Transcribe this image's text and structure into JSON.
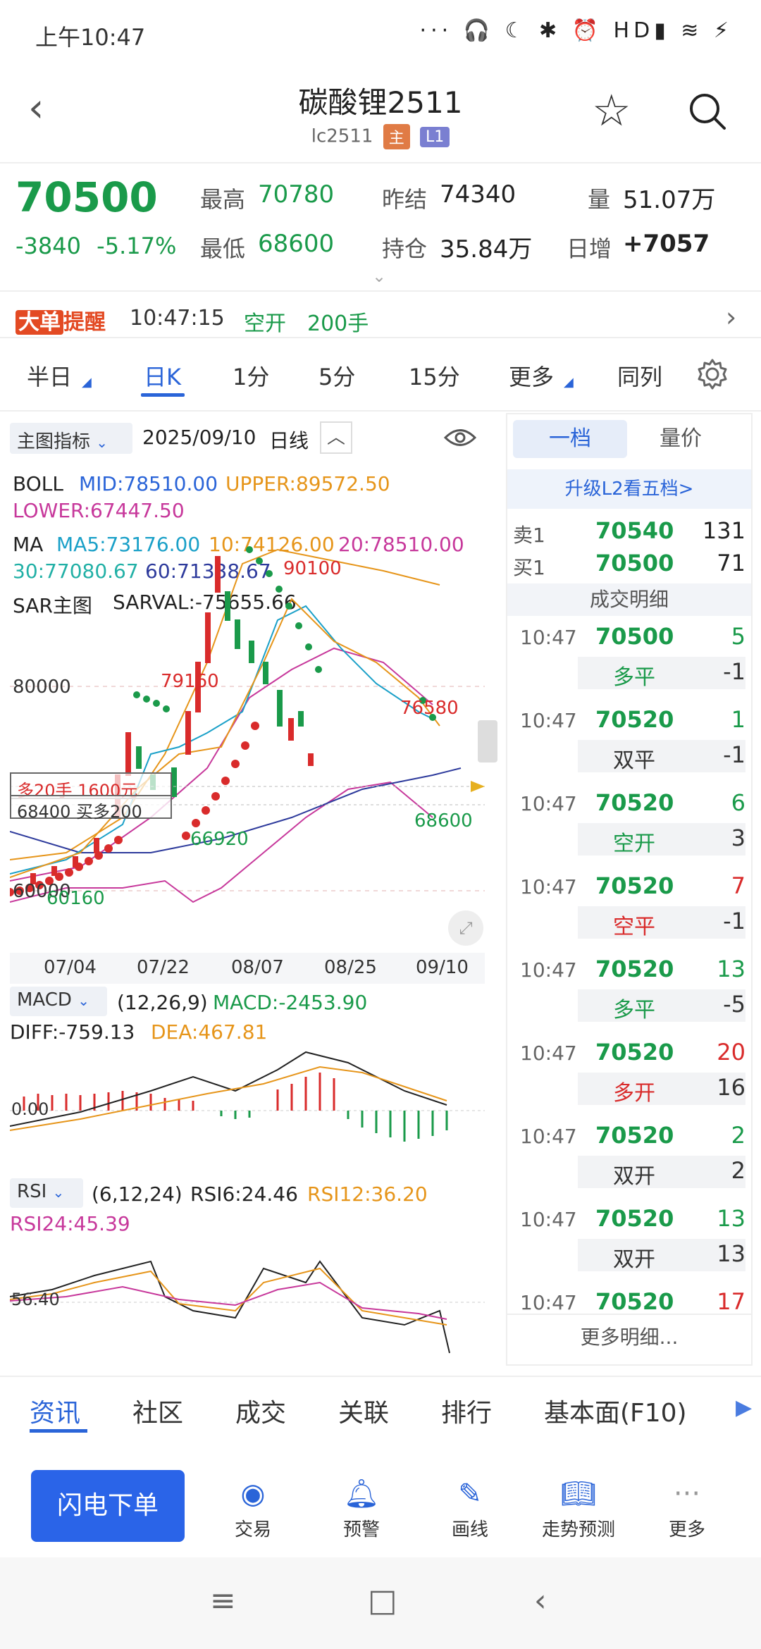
{
  "status_bar": {
    "time": "上午10:47",
    "icons": "··· 🎧 ☾ ✱ ⏰ HD▮ ≋ ⚡"
  },
  "header": {
    "title": "碳酸锂2511",
    "code": "lc2511",
    "tag_main": "主",
    "tag_level": "L1"
  },
  "quote": {
    "price": "70500",
    "change": "-3840",
    "change_pct": "-5.17%",
    "high_label": "最高",
    "high": "70780",
    "low_label": "最低",
    "low": "68600",
    "prev_label": "昨结",
    "prev": "74340",
    "oi_label": "持仓",
    "oi": "35.84万",
    "vol_label": "量",
    "vol": "51.07万",
    "daily_label": "日增",
    "daily": "+7057"
  },
  "alert": {
    "badge1": "大单",
    "badge2": "提醒",
    "time": "10:47:15",
    "action": "空开",
    "qty": "200手"
  },
  "period_tabs": [
    "半日",
    "日K",
    "1分",
    "5分",
    "15分",
    "更多",
    "同列"
  ],
  "chart_header": {
    "indicator_select": "主图指标",
    "date": "2025/09/10",
    "period": "日线"
  },
  "boll": {
    "label": "BOLL",
    "mid": "MID:78510.00",
    "upper": "UPPER:89572.50",
    "lower": "LOWER:67447.50"
  },
  "ma": {
    "label": "MA",
    "ma5": "MA5:73176.00",
    "ma10": "10:74126.00",
    "ma20": "20:78510.00",
    "ma30": "30:77080.67",
    "ma60": "60:71338.67"
  },
  "sar": {
    "label": "SAR主图",
    "value": "SARVAL:-75655.66"
  },
  "chart_annotations": {
    "level_80000": "80000",
    "level_60000": "60000",
    "peak": "90100",
    "p79160": "79160",
    "p76580": "76580",
    "p66920": "66920",
    "p68600": "68600",
    "p60160": "60160",
    "order1": "多20手 1600元",
    "order2": "68400 买多200"
  },
  "x_ticks": [
    "07/04",
    "07/22",
    "08/07",
    "08/25",
    "09/10"
  ],
  "macd": {
    "select": "MACD",
    "params": "(12,26,9)",
    "value": "MACD:-2453.90",
    "diff": "DIFF:-759.13",
    "dea": "DEA:467.81",
    "zero": "0.00"
  },
  "rsi": {
    "select": "RSI",
    "params": "(6,12,24)",
    "rsi6": "RSI6:24.46",
    "rsi12": "RSI12:36.20",
    "rsi24": "RSI24:45.39",
    "level": "56.40"
  },
  "right_panel": {
    "tab1": "一档",
    "tab2": "量价",
    "upgrade": "升级L2看五档>",
    "sell_label": "卖1",
    "sell_price": "70540",
    "sell_vol": "131",
    "buy_label": "买1",
    "buy_price": "70500",
    "buy_vol": "71",
    "detail_header": "成交明细",
    "trades": [
      {
        "time": "10:47",
        "price": "70500",
        "vol": "5",
        "vol_color": "#1a9a4a",
        "action": "多平",
        "act_color": "#1a9a4a",
        "act_vol": "-1"
      },
      {
        "time": "10:47",
        "price": "70520",
        "vol": "1",
        "vol_color": "#1a9a4a",
        "action": "双平",
        "act_color": "#333333",
        "act_vol": "-1"
      },
      {
        "time": "10:47",
        "price": "70520",
        "vol": "6",
        "vol_color": "#1a9a4a",
        "action": "空开",
        "act_color": "#1a9a4a",
        "act_vol": "3"
      },
      {
        "time": "10:47",
        "price": "70520",
        "vol": "7",
        "vol_color": "#d92b2b",
        "action": "空平",
        "act_color": "#d92b2b",
        "act_vol": "-1"
      },
      {
        "time": "10:47",
        "price": "70520",
        "vol": "13",
        "vol_color": "#1a9a4a",
        "action": "多平",
        "act_color": "#1a9a4a",
        "act_vol": "-5"
      },
      {
        "time": "10:47",
        "price": "70520",
        "vol": "20",
        "vol_color": "#d92b2b",
        "action": "多开",
        "act_color": "#d92b2b",
        "act_vol": "16"
      },
      {
        "time": "10:47",
        "price": "70520",
        "vol": "2",
        "vol_color": "#1a9a4a",
        "action": "双开",
        "act_color": "#333333",
        "act_vol": "2"
      },
      {
        "time": "10:47",
        "price": "70520",
        "vol": "13",
        "vol_color": "#1a9a4a",
        "action": "双开",
        "act_color": "#333333",
        "act_vol": "13"
      },
      {
        "time": "10:47",
        "price": "70520",
        "vol": "17",
        "vol_color": "#d92b2b"
      }
    ],
    "more": "更多明细..."
  },
  "bottom_tabs": [
    "资讯",
    "社区",
    "成交",
    "关联",
    "排行",
    "基本面(F10)"
  ],
  "actions": {
    "flash": "闪电下单",
    "trade": "交易",
    "alert": "预警",
    "draw": "画线",
    "predict": "走势预测",
    "more": "更多"
  },
  "colors": {
    "up": "#d92b2b",
    "down": "#1a9a4a",
    "accent": "#2a64d8"
  }
}
